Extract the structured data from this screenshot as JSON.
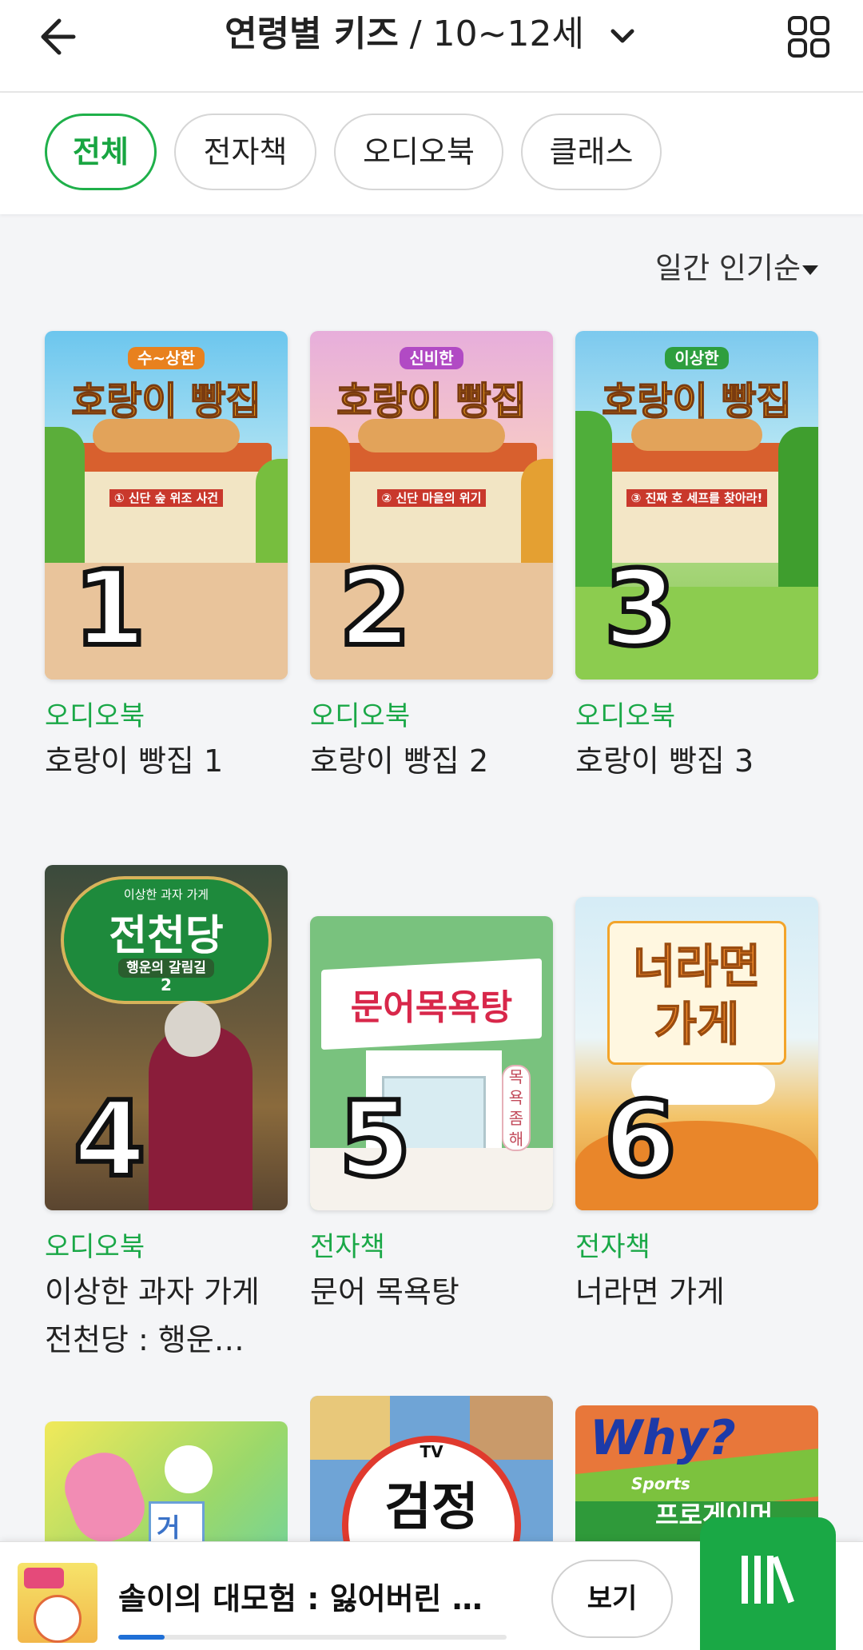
{
  "header": {
    "title_bold": "연령별 키즈",
    "title_rest": " / 10~12세"
  },
  "filters": [
    {
      "label": "전체",
      "active": true
    },
    {
      "label": "전자책",
      "active": false
    },
    {
      "label": "오디오북",
      "active": false
    },
    {
      "label": "클래스",
      "active": false
    }
  ],
  "sort": {
    "label": "일간 인기순"
  },
  "books": [
    {
      "rank": "1",
      "badge": "오디오북",
      "title": "호랑이 빵집 1",
      "cover_tag": "수~상한",
      "cover_title": "호랑이 빵집",
      "cover_sub": "① 신단 숲 위조 사건"
    },
    {
      "rank": "2",
      "badge": "오디오북",
      "title": "호랑이 빵집 2",
      "cover_tag": "신비한",
      "cover_title": "호랑이 빵집",
      "cover_sub": "② 신단 마을의 위기"
    },
    {
      "rank": "3",
      "badge": "오디오북",
      "title": "호랑이 빵집 3",
      "cover_tag": "이상한",
      "cover_title": "호랑이 빵집",
      "cover_sub": "③ 진짜 호 세프를 찾아라!"
    },
    {
      "rank": "4",
      "badge": "오디오북",
      "title": "이상한 과자 가게 전천당 : 행운…",
      "cover_tag": "이상한 과자 가게",
      "cover_title": "전천당",
      "cover_sub": "행운의 갈림길",
      "cover_num": "2"
    },
    {
      "rank": "5",
      "badge": "전자책",
      "title": "문어 목욕탕",
      "cover_title": "문어목욕탕",
      "cover_sub": "목욕좀해"
    },
    {
      "rank": "6",
      "badge": "전자책",
      "title": "너라면 가게",
      "cover_title": "너라면",
      "cover_title2": "가게"
    }
  ],
  "partial_covers": [
    {
      "cover_title": "거"
    },
    {
      "cover_tag": "TV",
      "cover_title": "검정"
    },
    {
      "cover_title": "Why?",
      "cover_tag": "Sports",
      "cover_sub": "프로게이머"
    }
  ],
  "player": {
    "title": "솔이의 대모험 : 잃어버린 몸…",
    "button": "보기",
    "progress": 0.12
  },
  "colors": {
    "accent": "#1aa847",
    "progress": "#1f6fd6"
  }
}
